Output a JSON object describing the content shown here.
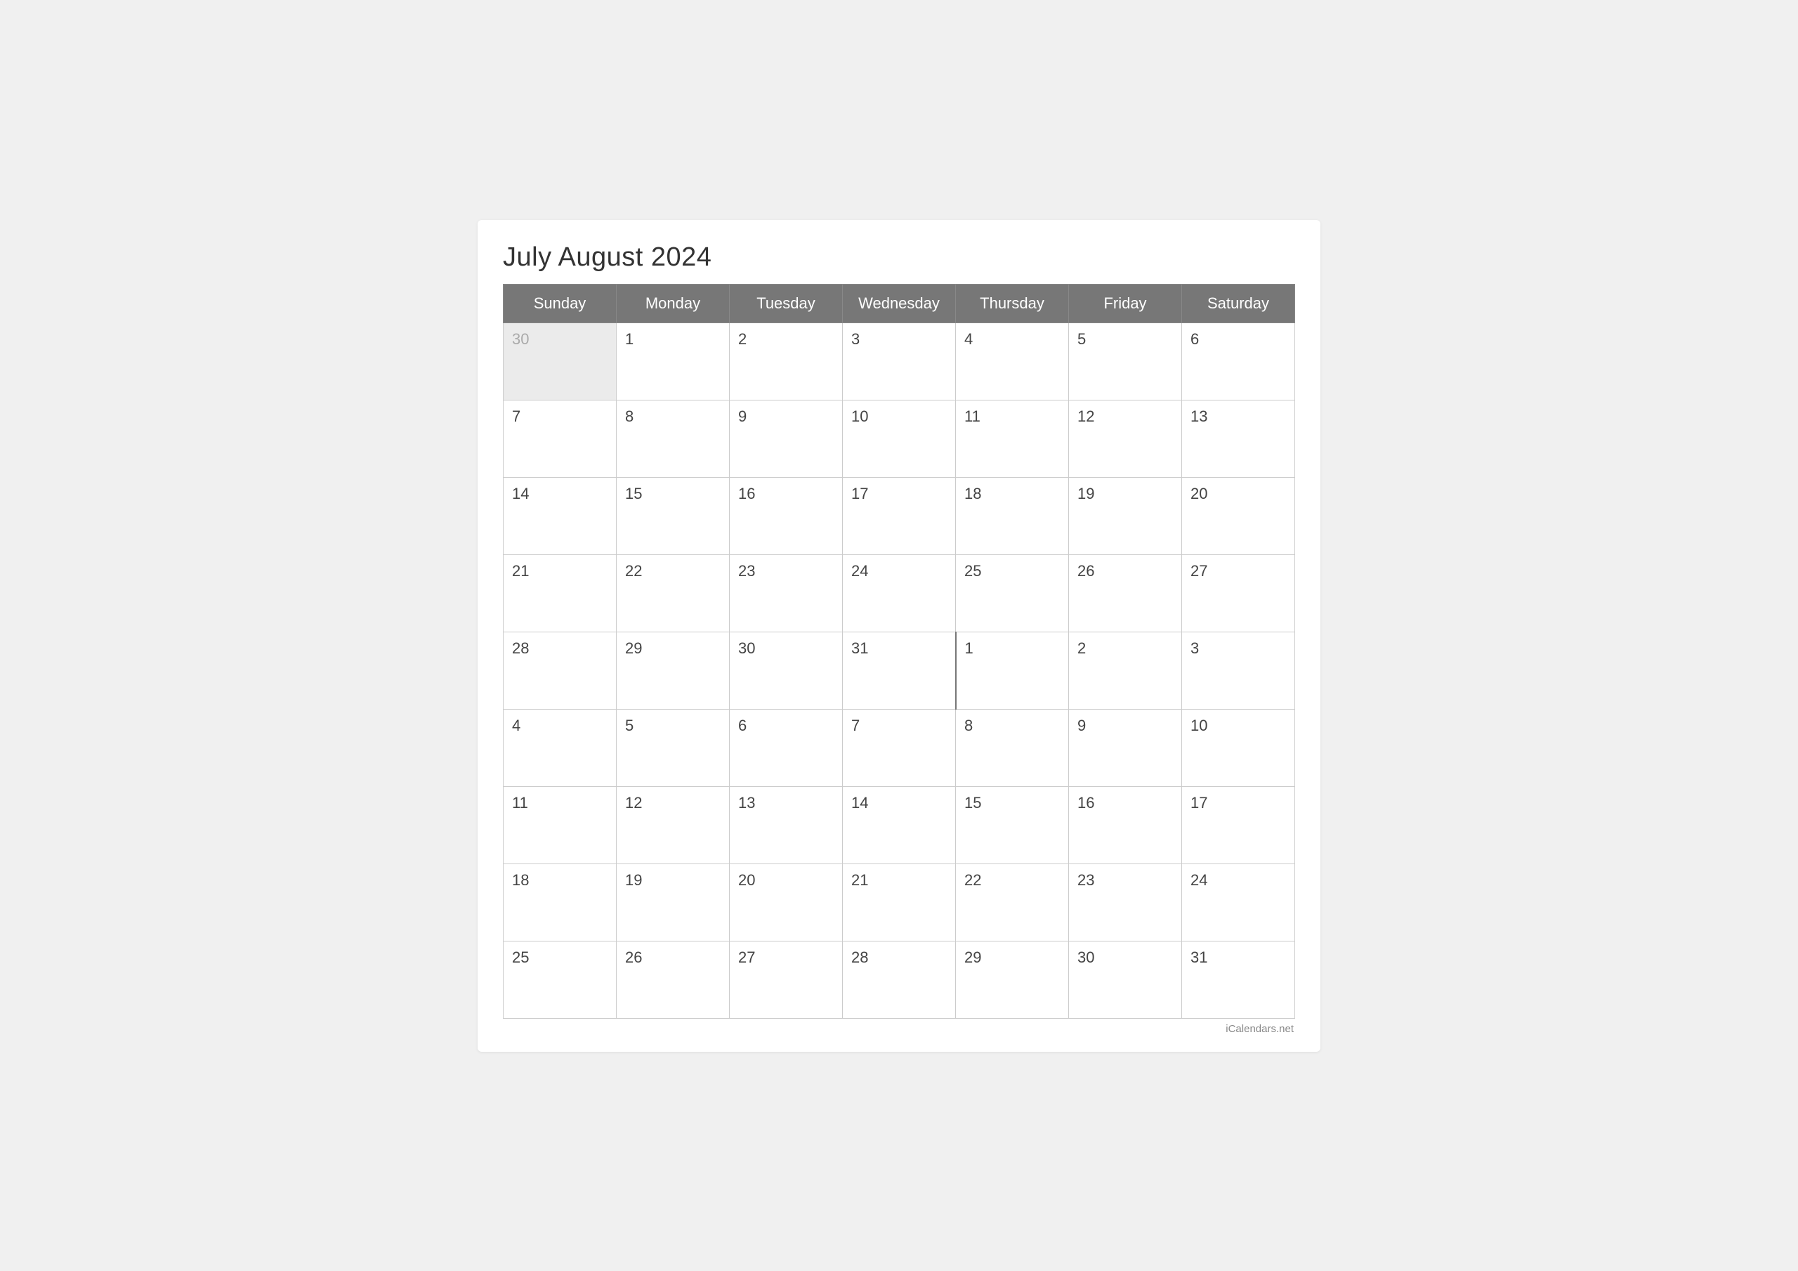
{
  "title": "July August 2024",
  "watermark": "iCalendars.net",
  "headers": [
    "Sunday",
    "Monday",
    "Tuesday",
    "Wednesday",
    "Thursday",
    "Friday",
    "Saturday"
  ],
  "weeks": [
    [
      {
        "day": "30",
        "type": "prev-month"
      },
      {
        "day": "1",
        "type": "current"
      },
      {
        "day": "2",
        "type": "current"
      },
      {
        "day": "3",
        "type": "current"
      },
      {
        "day": "4",
        "type": "current"
      },
      {
        "day": "5",
        "type": "current"
      },
      {
        "day": "6",
        "type": "current"
      }
    ],
    [
      {
        "day": "7",
        "type": "current"
      },
      {
        "day": "8",
        "type": "current"
      },
      {
        "day": "9",
        "type": "current"
      },
      {
        "day": "10",
        "type": "current"
      },
      {
        "day": "11",
        "type": "current"
      },
      {
        "day": "12",
        "type": "current"
      },
      {
        "day": "13",
        "type": "current"
      }
    ],
    [
      {
        "day": "14",
        "type": "current"
      },
      {
        "day": "15",
        "type": "current"
      },
      {
        "day": "16",
        "type": "current"
      },
      {
        "day": "17",
        "type": "current"
      },
      {
        "day": "18",
        "type": "current"
      },
      {
        "day": "19",
        "type": "current"
      },
      {
        "day": "20",
        "type": "current"
      }
    ],
    [
      {
        "day": "21",
        "type": "current"
      },
      {
        "day": "22",
        "type": "current"
      },
      {
        "day": "23",
        "type": "current"
      },
      {
        "day": "24",
        "type": "current"
      },
      {
        "day": "25",
        "type": "current"
      },
      {
        "day": "26",
        "type": "current"
      },
      {
        "day": "27",
        "type": "current"
      }
    ],
    [
      {
        "day": "28",
        "type": "current"
      },
      {
        "day": "29",
        "type": "current"
      },
      {
        "day": "30",
        "type": "current"
      },
      {
        "day": "31",
        "type": "current"
      },
      {
        "day": "1",
        "type": "next-month month-separator-left"
      },
      {
        "day": "2",
        "type": "next-month"
      },
      {
        "day": "3",
        "type": "next-month"
      }
    ],
    [
      {
        "day": "4",
        "type": "next-month"
      },
      {
        "day": "5",
        "type": "next-month"
      },
      {
        "day": "6",
        "type": "next-month"
      },
      {
        "day": "7",
        "type": "next-month"
      },
      {
        "day": "8",
        "type": "next-month"
      },
      {
        "day": "9",
        "type": "next-month"
      },
      {
        "day": "10",
        "type": "next-month"
      }
    ],
    [
      {
        "day": "11",
        "type": "next-month"
      },
      {
        "day": "12",
        "type": "next-month"
      },
      {
        "day": "13",
        "type": "next-month"
      },
      {
        "day": "14",
        "type": "next-month"
      },
      {
        "day": "15",
        "type": "next-month"
      },
      {
        "day": "16",
        "type": "next-month"
      },
      {
        "day": "17",
        "type": "next-month"
      }
    ],
    [
      {
        "day": "18",
        "type": "next-month"
      },
      {
        "day": "19",
        "type": "next-month"
      },
      {
        "day": "20",
        "type": "next-month"
      },
      {
        "day": "21",
        "type": "next-month"
      },
      {
        "day": "22",
        "type": "next-month"
      },
      {
        "day": "23",
        "type": "next-month"
      },
      {
        "day": "24",
        "type": "next-month"
      }
    ],
    [
      {
        "day": "25",
        "type": "next-month"
      },
      {
        "day": "26",
        "type": "next-month"
      },
      {
        "day": "27",
        "type": "next-month"
      },
      {
        "day": "28",
        "type": "next-month"
      },
      {
        "day": "29",
        "type": "next-month"
      },
      {
        "day": "30",
        "type": "next-month"
      },
      {
        "day": "31",
        "type": "next-month"
      }
    ]
  ]
}
